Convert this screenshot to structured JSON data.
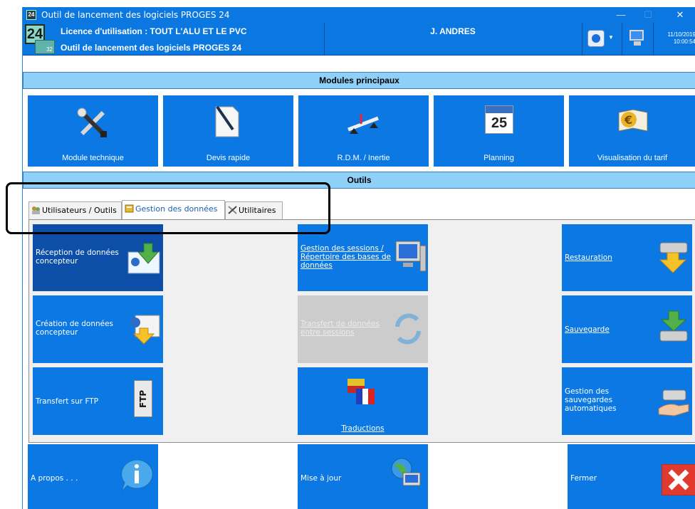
{
  "window": {
    "title": "Outil de lancement des logiciels PROGES 24",
    "icon_label": "24",
    "minimize": "—",
    "maximize": "☐",
    "close": "✕"
  },
  "header": {
    "logo_main": "24",
    "logo_badge": "32",
    "licence": "Licence d'utilisation : TOUT L'ALU ET LE PVC",
    "subtitle": "Outil de lancement des logiciels PROGES 24",
    "user": "J. ANDRES",
    "date": "11/10/2019",
    "time": "10:00:54"
  },
  "sections": {
    "modules": "Modules principaux",
    "outils": "Outils"
  },
  "modules": [
    {
      "label": "Module technique",
      "icon": "tools-icon"
    },
    {
      "label": "Devis rapide",
      "icon": "document-pen-icon"
    },
    {
      "label": "R.D.M. / Inertie",
      "icon": "beam-icon"
    },
    {
      "label": "Planning",
      "icon": "calendar-icon",
      "calendar_day": "25"
    },
    {
      "label": "Visualisation du tarif",
      "icon": "euro-book-icon"
    }
  ],
  "tabs": [
    {
      "label": "Utilisateurs / Outils",
      "active": false
    },
    {
      "label": "Gestion des données",
      "active": true
    },
    {
      "label": "Utilitaires",
      "active": false
    }
  ],
  "tools": {
    "reception": "Réception de données concepteur",
    "creation": "Création de données concepteur",
    "ftp": "Transfert sur FTP",
    "ftp_icon_text": "FTP",
    "sessions": "Gestion des sessions / Répertoire des bases de données",
    "transfert": "Transfert de données entre sessions",
    "traductions": "Traductions",
    "restauration": "Restauration",
    "sauvegarde": "Sauvegarde",
    "gestion_sauvegardes": "Gestion des sauvegardes automatiques"
  },
  "bottom": {
    "apropos": "A propos . . .",
    "miseajour": "Mise à jour",
    "fermer": "Fermer"
  },
  "colors": {
    "accent": "#0b78e3",
    "section_bar": "#8ed0f7",
    "selected_tile": "#0d4fa8",
    "disabled_tile": "#cccccc",
    "close_red": "#e03a2f"
  }
}
